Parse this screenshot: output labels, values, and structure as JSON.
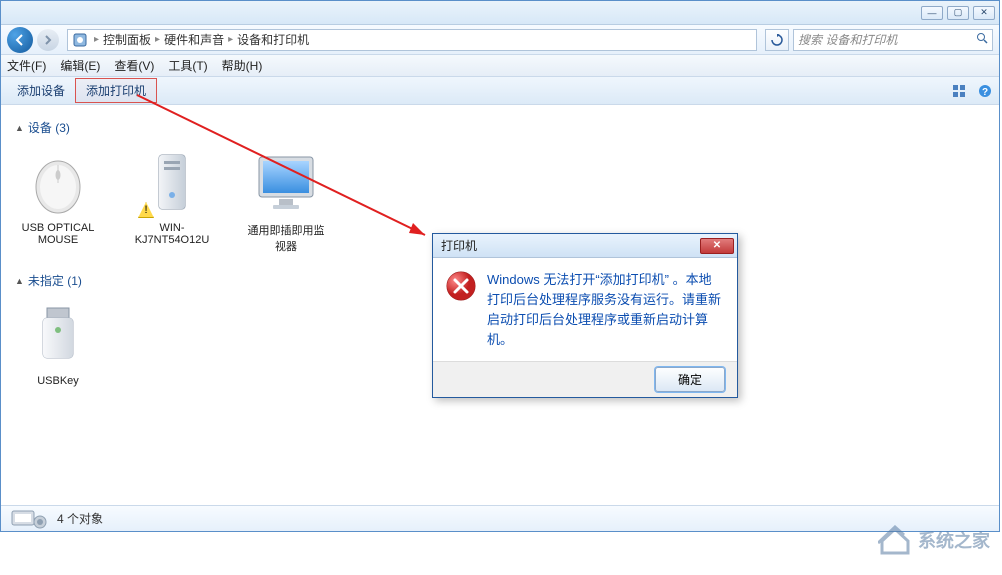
{
  "window_controls": {
    "min": "—",
    "max": "▢",
    "close": "✕"
  },
  "breadcrumb": {
    "root_icon": "⚙",
    "items": [
      "控制面板",
      "硬件和声音",
      "设备和打印机"
    ]
  },
  "search": {
    "placeholder": "搜索 设备和打印机"
  },
  "menubar": [
    "文件(F)",
    "编辑(E)",
    "查看(V)",
    "工具(T)",
    "帮助(H)"
  ],
  "toolbar": {
    "add_device": "添加设备",
    "add_printer": "添加打印机"
  },
  "sections": {
    "devices": {
      "title": "设备 (3)",
      "items": [
        {
          "name": "USB OPTICAL MOUSE",
          "has_warning": false,
          "icon": "mouse"
        },
        {
          "name": "WIN-KJ7NT54O12U",
          "has_warning": true,
          "icon": "pc"
        },
        {
          "name": "通用即插即用监视器",
          "has_warning": false,
          "icon": "monitor"
        }
      ]
    },
    "unspecified": {
      "title": "未指定 (1)",
      "items": [
        {
          "name": "USBKey",
          "has_warning": false,
          "icon": "usb"
        }
      ]
    }
  },
  "statusbar": {
    "count_text": "4 个对象"
  },
  "dialog": {
    "title": "打印机",
    "message": "Windows 无法打开“添加打印机” 。本地打印后台处理程序服务没有运行。请重新启动打印后台处理程序或重新启动计算机。",
    "ok": "确定"
  },
  "watermark": "系统之家"
}
